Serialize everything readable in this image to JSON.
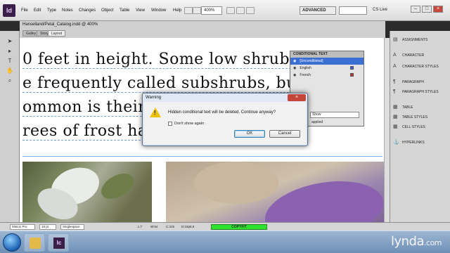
{
  "menubar": {
    "app_icon": "Id",
    "items": [
      "File",
      "Edit",
      "Type",
      "Notes",
      "Changes",
      "Object",
      "Table",
      "View",
      "Window",
      "Help"
    ],
    "zoom": "400%",
    "workspace": "ADVANCED",
    "cs_live": "CS Live",
    "win_min": "–",
    "win_max": "□",
    "win_close": "×"
  },
  "document": {
    "title": "Hanselland/Petal_Catalog.indd @ 400%",
    "tabs": [
      "Galley",
      "Story",
      "Layout"
    ],
    "active_tab": "Layout"
  },
  "tools": [
    "selection-tool",
    "direct-selection-tool",
    "type-tool",
    "hand-tool",
    "zoom-tool"
  ],
  "text_lines": [
    "0 feet in height. Some low shrubs",
    "e frequently called subshrubs, but",
    "ommon is their",
    "rees of frost ha"
  ],
  "conditional_text_panel": {
    "title": "CONDITIONAL TEXT",
    "rows": [
      {
        "label": "[Unconditional]",
        "selected": true,
        "color": ""
      },
      {
        "label": "English",
        "selected": false,
        "color": "#3a5fd6"
      },
      {
        "label": "French",
        "selected": false,
        "color": "#c43030"
      }
    ],
    "show": "Show",
    "applied": "applied"
  },
  "right_panel": {
    "items": [
      {
        "icon": "assignments-icon",
        "label": "ASSIGNMENTS"
      },
      {
        "icon": "character-icon",
        "label": "CHARACTER"
      },
      {
        "icon": "character-styles-icon",
        "label": "CHARACTER STYLES"
      },
      {
        "icon": "paragraph-icon",
        "label": "PARAGRAPH"
      },
      {
        "icon": "paragraph-styles-icon",
        "label": "PARAGRAPH STYLES"
      },
      {
        "icon": "table-icon",
        "label": "TABLE"
      },
      {
        "icon": "table-styles-icon",
        "label": "TABLE STYLES"
      },
      {
        "icon": "cell-styles-icon",
        "label": "CELL STYLES"
      },
      {
        "icon": "hyperlinks-icon",
        "label": "HYPERLINKS"
      }
    ]
  },
  "dialog": {
    "title": "Warning",
    "close": "×",
    "message": "Hidden conditional text will be deleted. Continue anyway?",
    "checkbox_label": "Don't show again",
    "ok": "OK",
    "cancel": "Cancel"
  },
  "statusbar": {
    "font": "Minion Pro",
    "size": "18 pt",
    "spacing": "Singlespace",
    "line": "L:7",
    "words": "W:54",
    "chars": "C:315",
    "depth": "D:16p6.5",
    "copyfit": "COPYFIT"
  },
  "taskbar": {
    "watermark": "lynda",
    "watermark_suffix": ".com"
  }
}
